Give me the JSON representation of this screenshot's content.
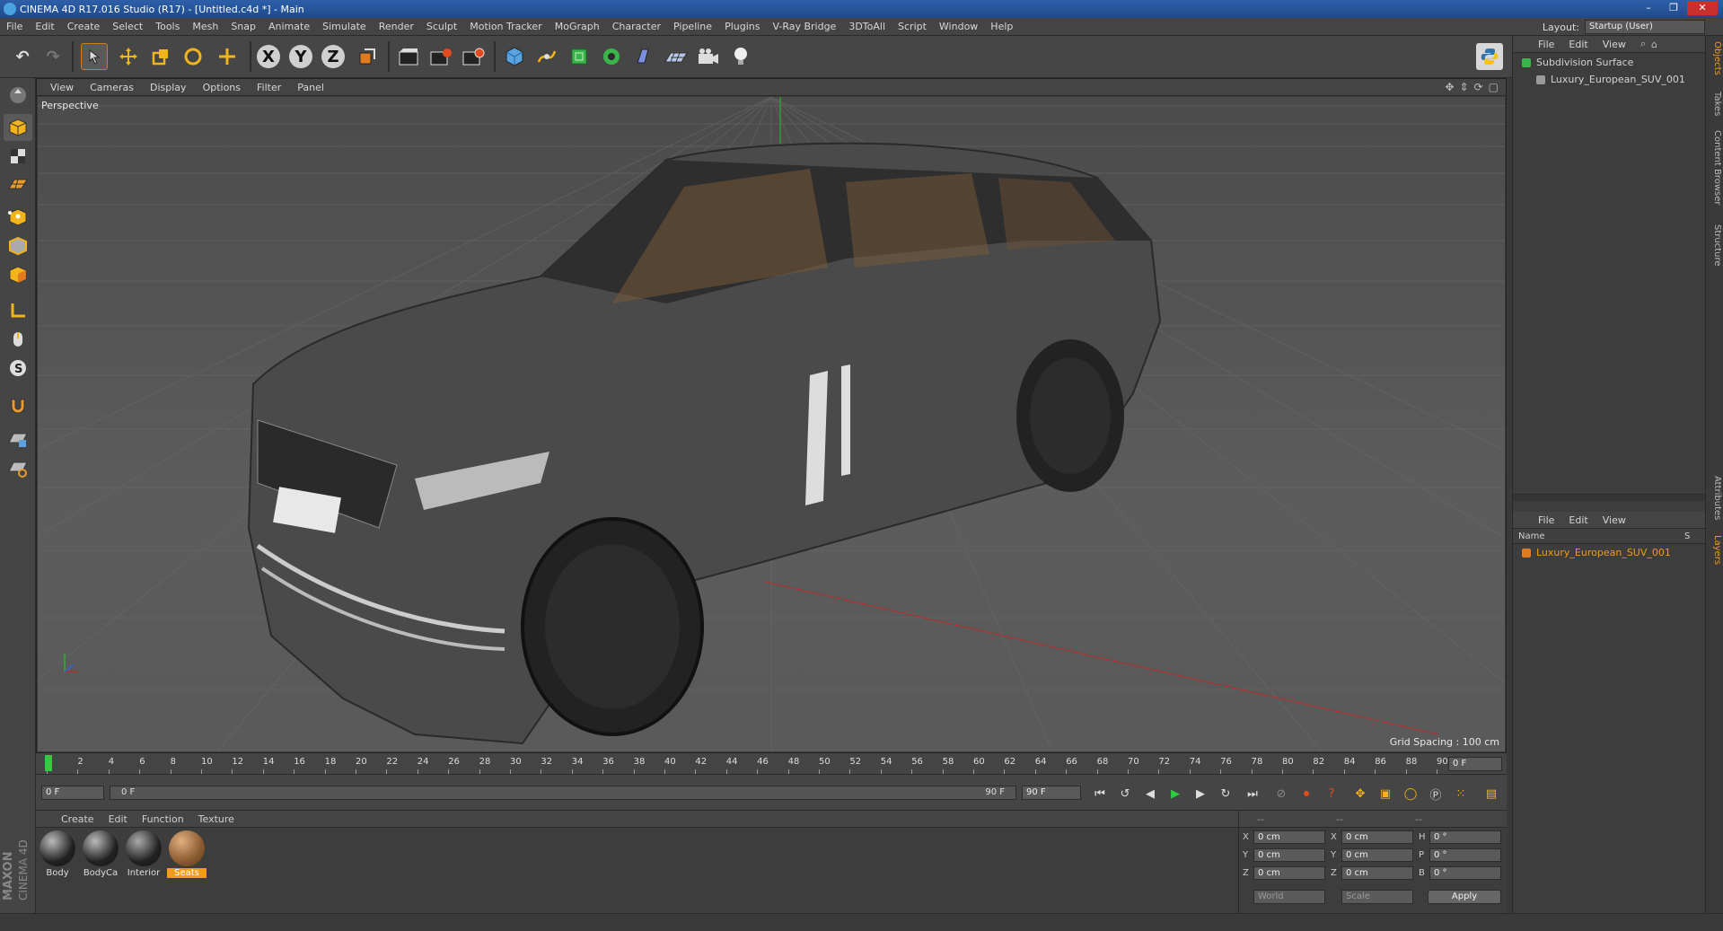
{
  "window": {
    "title": "CINEMA 4D R17.016 Studio (R17) - [Untitled.c4d *] - Main",
    "minimize": "–",
    "restore": "❐",
    "close": "✕"
  },
  "menu": [
    "File",
    "Edit",
    "Create",
    "Select",
    "Tools",
    "Mesh",
    "Snap",
    "Animate",
    "Simulate",
    "Render",
    "Sculpt",
    "Motion Tracker",
    "MoGraph",
    "Character",
    "Pipeline",
    "Plugins",
    "V-Ray Bridge",
    "3DToAll",
    "Script",
    "Window",
    "Help"
  ],
  "layout": {
    "label": "Layout:",
    "value": "Startup (User)"
  },
  "toolbar": {
    "undo_label": "↶",
    "redo_label": "↷",
    "x_label": "X",
    "y_label": "Y",
    "z_label": "Z"
  },
  "viewport": {
    "menu": [
      "View",
      "Cameras",
      "Display",
      "Options",
      "Filter",
      "Panel"
    ],
    "label": "Perspective",
    "grid_spacing": "Grid Spacing : 100 cm"
  },
  "objects_panel": {
    "menu": [
      "File",
      "Edit",
      "View"
    ],
    "items": [
      {
        "name": "Subdivision Surface"
      },
      {
        "name": "Luxury_European_SUV_001"
      }
    ]
  },
  "layers_panel": {
    "menu": [
      "File",
      "Edit",
      "View"
    ],
    "col_name": "Name",
    "col_s": "S",
    "items": [
      {
        "name": "Luxury_European_SUV_001"
      }
    ]
  },
  "side_tabs": [
    "Objects",
    "Takes",
    "Content Browser",
    "Structure",
    "Attributes",
    "Layers"
  ],
  "timeline": {
    "ticks": [
      "0",
      "2",
      "4",
      "6",
      "8",
      "10",
      "12",
      "14",
      "16",
      "18",
      "20",
      "22",
      "24",
      "26",
      "28",
      "30",
      "32",
      "34",
      "36",
      "38",
      "40",
      "42",
      "44",
      "46",
      "48",
      "50",
      "52",
      "54",
      "56",
      "58",
      "60",
      "62",
      "64",
      "66",
      "68",
      "70",
      "72",
      "74",
      "76",
      "78",
      "80",
      "82",
      "84",
      "86",
      "88",
      "90"
    ],
    "current": "0 F"
  },
  "transport": {
    "start": "0 F",
    "range_start": "0 F",
    "range_end": "90 F",
    "end": "90 F"
  },
  "materials": {
    "menu": [
      "Create",
      "Edit",
      "Function",
      "Texture"
    ],
    "items": [
      {
        "name": "Body"
      },
      {
        "name": "BodyCa"
      },
      {
        "name": "Interior"
      },
      {
        "name": "Seats"
      }
    ]
  },
  "coords": {
    "header": [
      "--",
      "--",
      "--"
    ],
    "rows": [
      {
        "a": "X",
        "av": "0 cm",
        "b": "X",
        "bv": "0 cm",
        "c": "H",
        "cv": "0 °"
      },
      {
        "a": "Y",
        "av": "0 cm",
        "b": "Y",
        "bv": "0 cm",
        "c": "P",
        "cv": "0 °"
      },
      {
        "a": "Z",
        "av": "0 cm",
        "b": "Z",
        "bv": "0 cm",
        "c": "B",
        "cv": "0 °"
      }
    ],
    "space": "World",
    "mode": "Scale",
    "apply": "Apply"
  },
  "brand": {
    "line1": "MAXON",
    "line2": "CINEMA 4D"
  },
  "colors": {
    "accent": "#f29a1a",
    "selected": "#e8a21e",
    "blue": "#4aa3df"
  }
}
